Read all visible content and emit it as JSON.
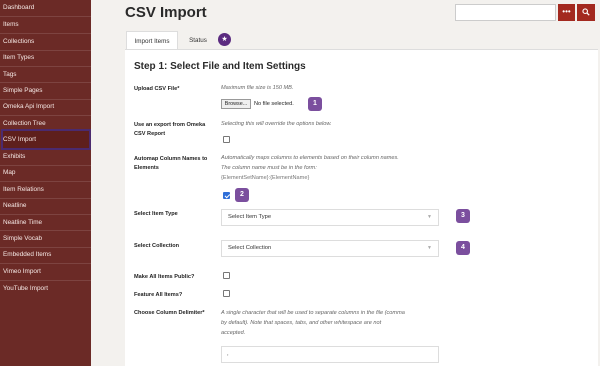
{
  "sidebar": {
    "items": [
      {
        "label": "Dashboard"
      },
      {
        "label": "Items"
      },
      {
        "label": "Collections"
      },
      {
        "label": "Item Types"
      },
      {
        "label": "Tags"
      },
      {
        "label": "Simple Pages"
      },
      {
        "label": "Omeka Api Import"
      },
      {
        "label": "Collection Tree"
      },
      {
        "label": "CSV Import",
        "active": true
      },
      {
        "label": "Exhibits"
      },
      {
        "label": "Map"
      },
      {
        "label": "Item Relations"
      },
      {
        "label": "Neatline"
      },
      {
        "label": "Neatline Time"
      },
      {
        "label": "Simple Vocab"
      },
      {
        "label": "Embedded Items"
      },
      {
        "label": "Vimeo Import"
      },
      {
        "label": "YouTube Import"
      }
    ]
  },
  "header": {
    "title": "CSV Import",
    "search": {
      "value": "",
      "options_icon": "ellipsis-icon",
      "submit_icon": "search-icon"
    }
  },
  "tabs": [
    {
      "label": "Import Items",
      "active": true
    },
    {
      "label": "Status",
      "active": false
    }
  ],
  "main": {
    "step_title": "Step 1: Select File and Item Settings",
    "upload": {
      "label": "Upload CSV File*",
      "description": "Maximum file size is 150 MB.",
      "browse_label": "Browse...",
      "file_status": "No file selected."
    },
    "omeka_export": {
      "label_line1": "Use an export from Omeka",
      "label_line2": "CSV Report",
      "description": "Selecting this will override the options below.",
      "checked": false
    },
    "automap": {
      "label_line1": "Automap Column Names to",
      "label_line2": "Elements",
      "desc_line1": "Automatically maps columns to elements based on their column names.",
      "desc_line2": "The column name must be in the form:",
      "desc_line3": "{ElementSetName}:{ElementName}",
      "checked": true
    },
    "item_type": {
      "label": "Select Item Type",
      "value": "Select Item Type"
    },
    "collection": {
      "label": "Select Collection",
      "value": "Select Collection"
    },
    "public": {
      "label": "Make All Items Public?",
      "checked": false
    },
    "feature": {
      "label": "Feature All Items?",
      "checked": false
    },
    "delimiter": {
      "label": "Choose Column Delimiter*",
      "desc_line1": "A single character that will be used to separate columns in the file (comma",
      "desc_line2": "by default). Note that spaces, tabs, and other whitespace are not",
      "desc_line3": "accepted.",
      "value": ","
    }
  },
  "badges": [
    "1",
    "2",
    "3",
    "4"
  ],
  "tab_badge_icon": "star-icon",
  "colors": {
    "sidebar": "#6b2a26",
    "accent": "#a3291f",
    "badge": "#7b4f9e",
    "highlight": "#4b2a6e"
  }
}
